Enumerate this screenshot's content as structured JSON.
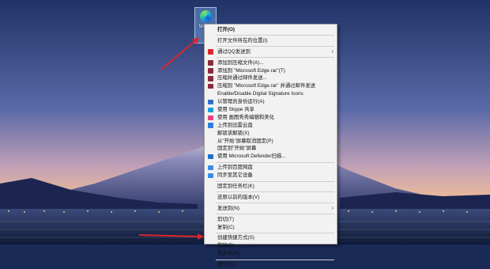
{
  "desktop": {
    "icon_label": "Micr E",
    "icon_name": "microsoft-edge-icon"
  },
  "menu": {
    "groups": [
      [
        {
          "label": "打开(O)",
          "bold": true,
          "icon": "none"
        }
      ],
      [
        {
          "label": "打开文件所在的位置(I)",
          "icon": "none"
        }
      ],
      [
        {
          "label": "通过QQ发送到",
          "icon": "qq-icon",
          "color": "#d9262c",
          "submenu": true
        }
      ],
      [
        {
          "label": "添加到压缩文件(A)...",
          "icon": "winrar-icon",
          "color": "#8a2a3a"
        },
        {
          "label": "添加到 \"Microsoft Edge.rar\"(T)",
          "icon": "winrar-icon",
          "color": "#8a2a3a"
        },
        {
          "label": "压缩并通过邮件发送...",
          "icon": "winrar-icon",
          "color": "#8a2a3a"
        },
        {
          "label": "压缩到 \"Microsoft Edge.rar\" 并通过邮件发送",
          "icon": "winrar-icon",
          "color": "#8a2a3a"
        },
        {
          "label": "Enable/Disable Digital Signature Icons",
          "icon": "none"
        },
        {
          "label": "以管理员身份运行(A)",
          "icon": "shield-icon",
          "color": "#2f6fc8"
        },
        {
          "label": "使用 Skype 共享",
          "icon": "skype-icon",
          "color": "#1a9ee0"
        },
        {
          "label": "使用 画图秀秀编辑和美化",
          "icon": "paint-icon",
          "color": "#e8407e"
        },
        {
          "label": "上传到迅雷云盘",
          "icon": "cloud-icon",
          "color": "#2d7de0"
        },
        {
          "label": "解锁该解锁(X)",
          "icon": "none"
        },
        {
          "label": "从\"开始\"屏幕取消固定(P)",
          "icon": "none"
        },
        {
          "label": "固定到\"开始\"屏幕",
          "icon": "none"
        },
        {
          "label": "使用 Microsoft Defender扫描...",
          "icon": "defender-icon",
          "color": "#1d6ed0"
        }
      ],
      [
        {
          "label": "上传到百度网盘",
          "icon": "baidu-cloud-icon",
          "color": "#3a8be8"
        },
        {
          "label": "同步至其它设备",
          "icon": "sync-cloud-icon",
          "color": "#3a8be8"
        }
      ],
      [
        {
          "label": "固定到任务栏(K)",
          "icon": "none"
        }
      ],
      [
        {
          "label": "还原以前的版本(V)",
          "icon": "none"
        }
      ],
      [
        {
          "label": "发送到(N)",
          "icon": "none",
          "submenu": true
        }
      ],
      [
        {
          "label": "剪切(T)",
          "icon": "none"
        },
        {
          "label": "复制(C)",
          "icon": "none"
        }
      ],
      [
        {
          "label": "创建快捷方式(S)",
          "icon": "none"
        },
        {
          "label": "删除(D)",
          "icon": "none"
        },
        {
          "label": "重命名(M)",
          "icon": "none"
        }
      ],
      [
        {
          "label": "属性(R)",
          "icon": "none"
        }
      ]
    ]
  },
  "colors": {
    "arrow": "#d8262c",
    "menu_bg": "#f2f2f2"
  }
}
